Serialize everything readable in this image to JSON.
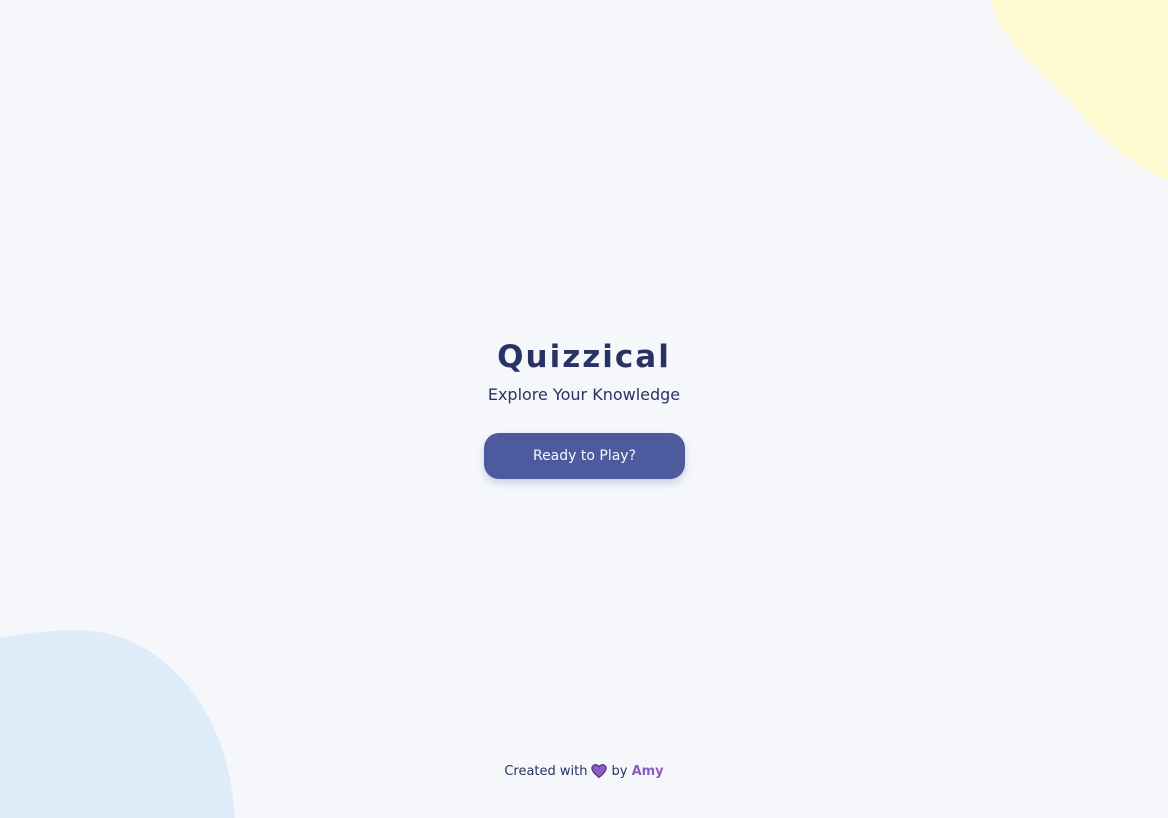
{
  "app": {
    "title": "Quizzical",
    "subtitle": "Explore Your Knowledge"
  },
  "start_button": {
    "label": "Ready to Play?"
  },
  "footer": {
    "prefix": "Created with",
    "heart_icon": "heart-icon",
    "by": "by",
    "author": "Amy"
  },
  "colors": {
    "background": "#f5f7fb",
    "text": "#293264",
    "button": "#4d5b9e",
    "button_text": "#f5f7fb",
    "blob_yellow": "#fffad1",
    "blob_blue": "#deebf8",
    "author": "#8a5cbf",
    "heart": "#8a5cbf"
  }
}
